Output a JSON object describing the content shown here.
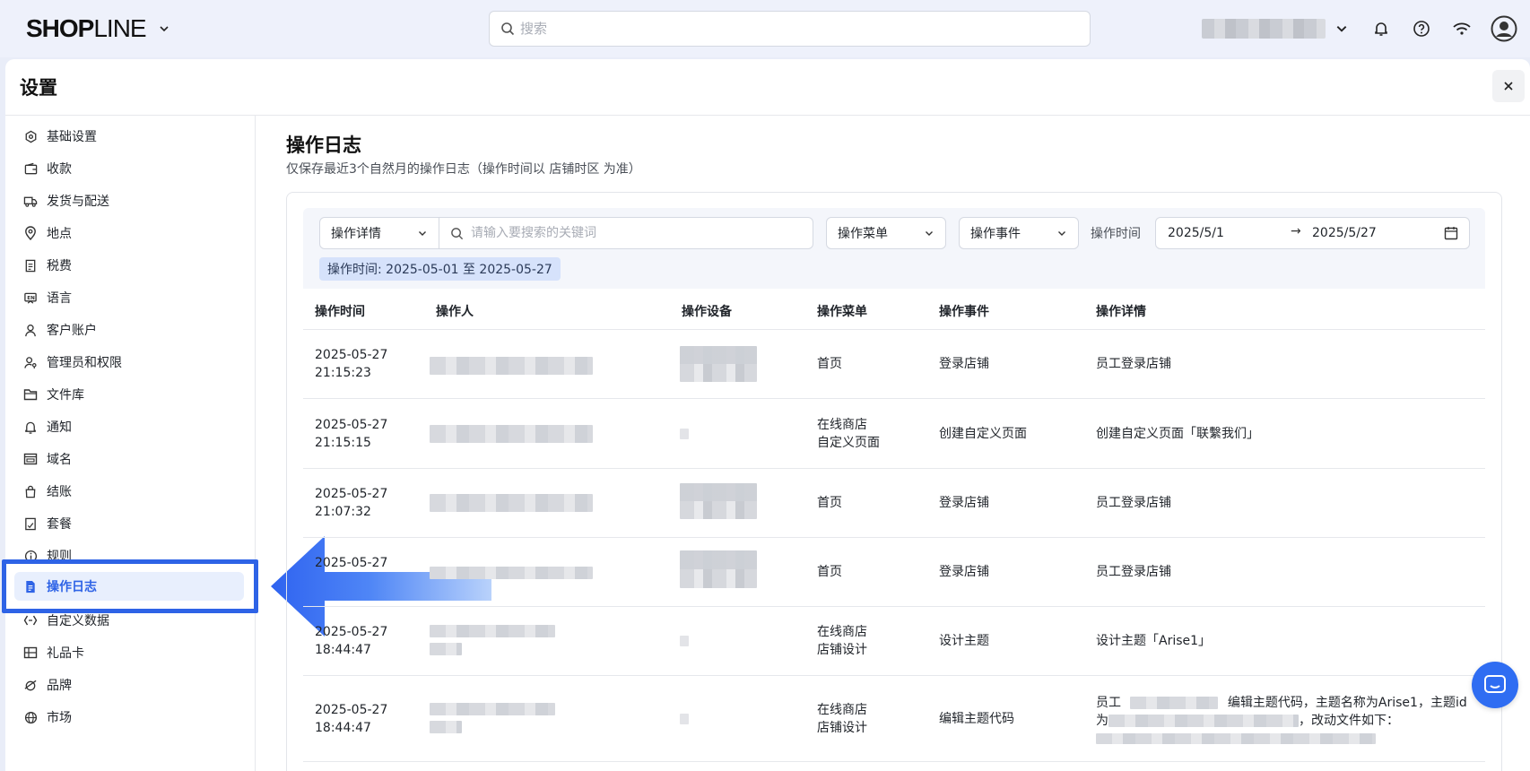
{
  "topbar": {
    "logo_bold": "SHOP",
    "logo_light": "LINE",
    "search_placeholder": "搜索"
  },
  "panel": {
    "title": "设置"
  },
  "sidebar": {
    "items": [
      {
        "label": "基础设置",
        "icon": "hexagon-settings-icon"
      },
      {
        "label": "收款",
        "icon": "wallet-icon"
      },
      {
        "label": "发货与配送",
        "icon": "truck-icon"
      },
      {
        "label": "地点",
        "icon": "location-pin-icon"
      },
      {
        "label": "税费",
        "icon": "receipt-icon"
      },
      {
        "label": "语言",
        "icon": "language-icon"
      },
      {
        "label": "客户账户",
        "icon": "user-icon"
      },
      {
        "label": "管理员和权限",
        "icon": "user-key-icon"
      },
      {
        "label": "文件库",
        "icon": "folder-icon"
      },
      {
        "label": "通知",
        "icon": "bell-icon"
      },
      {
        "label": "域名",
        "icon": "domain-icon"
      },
      {
        "label": "结账",
        "icon": "bag-icon"
      },
      {
        "label": "套餐",
        "icon": "plan-icon"
      },
      {
        "label": "规则",
        "icon": "info-icon"
      },
      {
        "label": "操作日志",
        "icon": "document-icon",
        "active": true
      },
      {
        "label": "自定义数据",
        "icon": "code-brackets-icon"
      },
      {
        "label": "礼品卡",
        "icon": "gift-card-icon"
      },
      {
        "label": "品牌",
        "icon": "brand-icon"
      },
      {
        "label": "市场",
        "icon": "globe-icon"
      }
    ]
  },
  "main": {
    "title": "操作日志",
    "subtitle": "仅保存最近3个自然月的操作日志（操作时间以 店铺时区 为准）",
    "filters": {
      "field_select": "操作详情",
      "keyword_placeholder": "请输入要搜索的关键词",
      "menu_select": "操作菜单",
      "event_select": "操作事件",
      "time_label": "操作时间",
      "date_start": "2025/5/1",
      "date_end": "2025/5/27",
      "arrow": "→"
    },
    "chip": "操作时间: 2025-05-01 至 2025-05-27",
    "table": {
      "headers": [
        "操作时间",
        "操作人",
        "操作设备",
        "操作菜单",
        "操作事件",
        "操作详情"
      ],
      "rows": [
        {
          "date": "2025-05-27",
          "time": "21:15:23",
          "menu1": "首页",
          "menu2": "",
          "event": "登录店铺",
          "detail": "员工登录店铺"
        },
        {
          "date": "2025-05-27",
          "time": "21:15:15",
          "menu1": "在线商店",
          "menu2": "自定义页面",
          "event": "创建自定义页面",
          "detail": "创建自定义页面「联繫我们」"
        },
        {
          "date": "2025-05-27",
          "time": "21:07:32",
          "menu1": "首页",
          "menu2": "",
          "event": "登录店铺",
          "detail": "员工登录店铺"
        },
        {
          "date": "2025-05-27",
          "time": "",
          "menu1": "首页",
          "menu2": "",
          "event": "登录店铺",
          "detail": "员工登录店铺"
        },
        {
          "date": "2025-05-27",
          "time": "18:44:47",
          "menu1": "在线商店",
          "menu2": "店铺设计",
          "event": "设计主题",
          "detail": "设计主题「Arise1」"
        },
        {
          "date": "2025-05-27",
          "time": "18:44:47",
          "menu1": "在线商店",
          "menu2": "店铺设计",
          "event": "编辑主题代码",
          "detail_p1": "员工",
          "detail_p2": "编辑主题代码，主题名称为Arise1，主题id",
          "detail_p3": "为",
          "detail_p4": "，改动文件如下："
        }
      ]
    }
  },
  "colors": {
    "accent": "#2e63e6",
    "active_bg": "#e8effd",
    "chip_bg": "#d6e2fb",
    "chat_bubble": "#2f6df2"
  }
}
